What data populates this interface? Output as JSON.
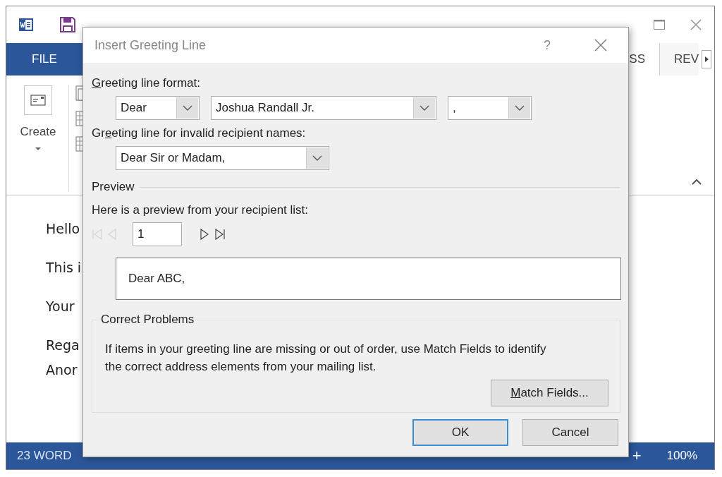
{
  "ribbon_tabs": [
    {
      "label": "FILE",
      "selected": false
    },
    {
      "label": "SS",
      "selected": true
    },
    {
      "label": "REV",
      "selected": false
    }
  ],
  "ribbon": {
    "create_label": "Create"
  },
  "document": {
    "lines": [
      "Hello",
      "This i",
      "Your",
      "Rega",
      "Anor"
    ]
  },
  "status_bar": {
    "word_count": "23 WORD",
    "zoom_in": "+",
    "zoom": "100%"
  },
  "dialog": {
    "title": "Insert Greeting Line",
    "help": "?",
    "format_label": {
      "key": "G",
      "rest": "reeting line format:"
    },
    "format_dropdowns": [
      {
        "value": "Dear",
        "kind": "short"
      },
      {
        "value": "Joshua Randall Jr.",
        "kind": "long"
      },
      {
        "value": ",",
        "kind": "short"
      }
    ],
    "invalid_label": {
      "lead": "Gr",
      "key": "e",
      "rest": "eting line for invalid recipient names:"
    },
    "invalid_dropdown": {
      "value": "Dear Sir or Madam,"
    },
    "preview_heading": "Preview",
    "preview_label": "Here is a preview from your recipient list:",
    "navigation": [
      {
        "kind": "first",
        "disabled": true
      },
      {
        "kind": "prev",
        "disabled": true
      },
      {
        "kind": "record",
        "value": "1"
      },
      {
        "kind": "next",
        "disabled": false
      },
      {
        "kind": "last",
        "disabled": false
      }
    ],
    "preview_text": "Dear ABC,",
    "problems_heading": "Correct Problems",
    "problems_text": "If items in your greeting line are missing or out of order, use Match Fields to identify the correct address elements from your mailing list.",
    "match_button": {
      "key": "M",
      "rest": "atch Fields..."
    },
    "buttons": [
      {
        "label": "OK",
        "default": true
      },
      {
        "label": "Cancel",
        "default": false
      }
    ]
  }
}
